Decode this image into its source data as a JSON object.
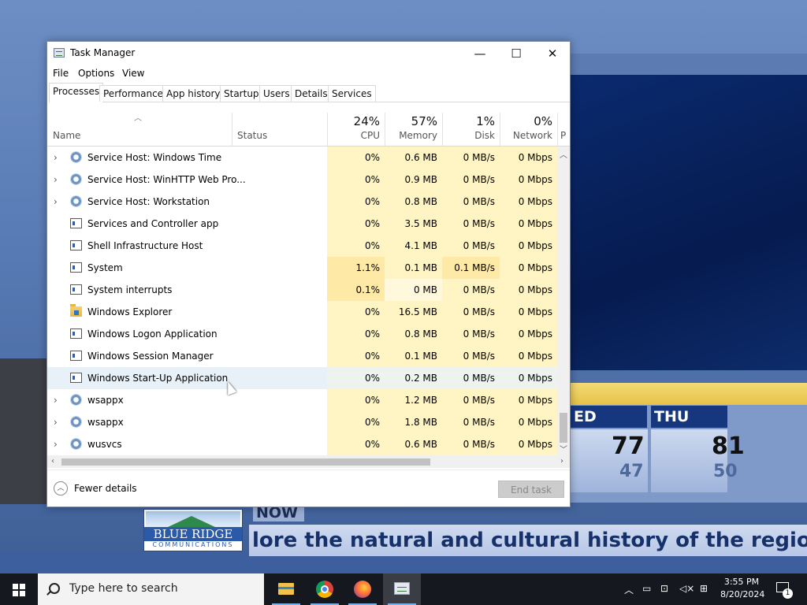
{
  "window": {
    "title": "Task Manager",
    "controls": {
      "minimize": "—",
      "maximize": "☐",
      "close": "✕"
    }
  },
  "menu": [
    "File",
    "Options",
    "View"
  ],
  "tabs": [
    "Processes",
    "Performance",
    "App history",
    "Startup",
    "Users",
    "Details",
    "Services"
  ],
  "active_tab": "Processes",
  "columns": {
    "name": "Name",
    "status": "Status",
    "cpu": {
      "pct": "24%",
      "label": "CPU"
    },
    "memory": {
      "pct": "57%",
      "label": "Memory"
    },
    "disk": {
      "pct": "1%",
      "label": "Disk"
    },
    "network": {
      "pct": "0%",
      "label": "Network"
    },
    "power_partial": "P"
  },
  "processes": [
    {
      "expand": "›",
      "icon": "gear-icon",
      "name": "Service Host: Windows Time",
      "cpu": "0%",
      "memory": "0.6 MB",
      "disk": "0 MB/s",
      "network": "0 Mbps"
    },
    {
      "expand": "›",
      "icon": "gear-icon",
      "name": "Service Host: WinHTTP Web Pro...",
      "cpu": "0%",
      "memory": "0.9 MB",
      "disk": "0 MB/s",
      "network": "0 Mbps"
    },
    {
      "expand": "›",
      "icon": "gear-icon",
      "name": "Service Host: Workstation",
      "cpu": "0%",
      "memory": "0.8 MB",
      "disk": "0 MB/s",
      "network": "0 Mbps"
    },
    {
      "expand": "",
      "icon": "window-app-icon",
      "name": "Services and Controller app",
      "cpu": "0%",
      "memory": "3.5 MB",
      "disk": "0 MB/s",
      "network": "0 Mbps"
    },
    {
      "expand": "",
      "icon": "window-app-icon",
      "name": "Shell Infrastructure Host",
      "cpu": "0%",
      "memory": "4.1 MB",
      "disk": "0 MB/s",
      "network": "0 Mbps"
    },
    {
      "expand": "",
      "icon": "window-app-icon",
      "name": "System",
      "cpu": "1.1%",
      "memory": "0.1 MB",
      "disk": "0.1 MB/s",
      "network": "0 Mbps"
    },
    {
      "expand": "",
      "icon": "window-app-icon",
      "name": "System interrupts",
      "cpu": "0.1%",
      "memory": "0 MB",
      "disk": "0 MB/s",
      "network": "0 Mbps"
    },
    {
      "expand": "",
      "icon": "folder-icon",
      "name": "Windows Explorer",
      "cpu": "0%",
      "memory": "16.5 MB",
      "disk": "0 MB/s",
      "network": "0 Mbps"
    },
    {
      "expand": "",
      "icon": "window-app-icon",
      "name": "Windows Logon Application",
      "cpu": "0%",
      "memory": "0.8 MB",
      "disk": "0 MB/s",
      "network": "0 Mbps"
    },
    {
      "expand": "",
      "icon": "window-app-icon",
      "name": "Windows Session Manager",
      "cpu": "0%",
      "memory": "0.1 MB",
      "disk": "0 MB/s",
      "network": "0 Mbps"
    },
    {
      "expand": "",
      "icon": "window-app-icon",
      "name": "Windows Start-Up Application",
      "cpu": "0%",
      "memory": "0.2 MB",
      "disk": "0 MB/s",
      "network": "0 Mbps"
    },
    {
      "expand": "›",
      "icon": "gear-icon",
      "name": "wsappx",
      "cpu": "0%",
      "memory": "1.2 MB",
      "disk": "0 MB/s",
      "network": "0 Mbps"
    },
    {
      "expand": "›",
      "icon": "gear-icon",
      "name": "wsappx",
      "cpu": "0%",
      "memory": "1.8 MB",
      "disk": "0 MB/s",
      "network": "0 Mbps"
    },
    {
      "expand": "›",
      "icon": "gear-icon",
      "name": "wusvcs",
      "cpu": "0%",
      "memory": "0.6 MB",
      "disk": "0 MB/s",
      "network": "0 Mbps"
    }
  ],
  "footer": {
    "fewer_details": "Fewer details",
    "end_task": "End task"
  },
  "background": {
    "weather": {
      "day1": "ED",
      "day1_hi": "77",
      "day1_lo": "47",
      "day2": "THU",
      "day2_hi": "81",
      "day2_lo": "50"
    },
    "now_label": "NOW",
    "logo_main": "BLUE RIDGE",
    "logo_sub": "COMMUNICATIONS",
    "ticker": "lore the natural and cultural history of the region"
  },
  "taskbar": {
    "search_placeholder": "Type here to search",
    "time": "3:55 PM",
    "date": "8/20/2024",
    "notification_count": "1"
  },
  "colors": {
    "cpu_highlight": "#ffe9a6",
    "usage_bg": "#fff4c4",
    "accent": "#0078d7"
  }
}
